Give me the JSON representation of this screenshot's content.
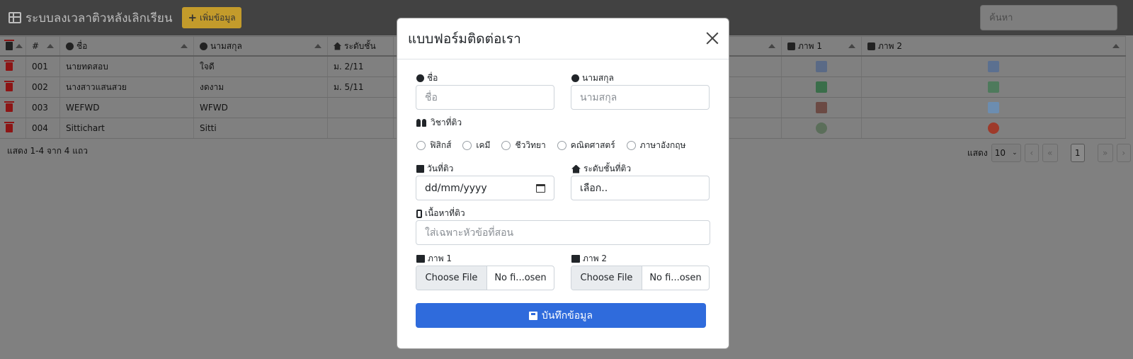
{
  "app": {
    "title": "ระบบลงเวลาติวหลังเลิกเรียน",
    "add_button": "เพิ่มข้อมูล",
    "search_placeholder": "ค้นหา"
  },
  "table": {
    "headers": [
      "#",
      "ชื่อ",
      "นามสกุล",
      "ระดับชั้น",
      "ภาพ 1",
      "ภาพ 2"
    ],
    "rows": [
      {
        "num": "001",
        "first": "นายทดสอบ",
        "last": "ใจดี",
        "level": "ม. 2/11"
      },
      {
        "num": "002",
        "first": "นางสาวแสนสวย",
        "last": "งดงาม",
        "level": "ม. 5/11"
      },
      {
        "num": "003",
        "first": "WEFWD",
        "last": "WFWD",
        "level": ""
      },
      {
        "num": "004",
        "first": "Sittichart",
        "last": "Sitti",
        "level": ""
      }
    ],
    "info": "แสดง 1-4 จาก 4 แถว"
  },
  "pager": {
    "show_label": "แสดง",
    "page_size": "10",
    "current_page": "1",
    "first": "‹",
    "prev": "«",
    "next": "»",
    "last": "›"
  },
  "modal": {
    "title": "แบบฟอร์มติดต่อเรา",
    "first_label": "ชื่อ",
    "first_placeholder": "ชื่อ",
    "last_label": "นามสกุล",
    "last_placeholder": "นามสกุล",
    "subject_label": "วิชาที่ติว",
    "subjects": [
      "ฟิสิกส์",
      "เคมี",
      "ชีววิทยา",
      "คณิตศาสตร์",
      "ภาษาอังกฤษ"
    ],
    "date_label": "วันที่ติว",
    "date_value": "dd/mm/yyyy",
    "level_label": "ระดับชั้นที่ติว",
    "level_value": "เลือก..",
    "content_label": "เนื้อหาที่ติว",
    "content_placeholder": "ใส่เฉพาะหัวข้อที่สอน",
    "image1_label": "ภาพ 1",
    "image2_label": "ภาพ 2",
    "choose_file": "Choose File",
    "no_file": "No fi...osen",
    "save_button": "บันทึกข้อมูล"
  }
}
